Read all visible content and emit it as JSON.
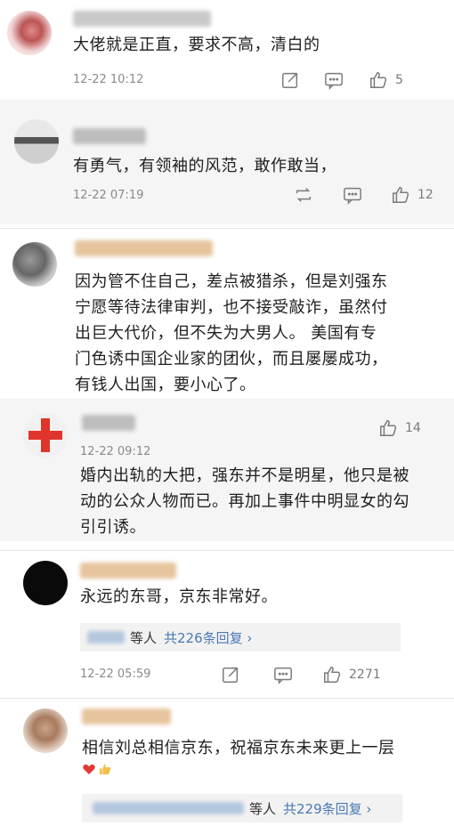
{
  "comments": [
    {
      "text": "大佬就是正直，要求不高，清白的",
      "time": "12-22 10:12",
      "likes": "5"
    },
    {
      "text": "有勇气，有领袖的风范，敢作敢当，",
      "time": "12-22 07:19",
      "likes": "12"
    },
    {
      "lines": [
        "因为管不住自己，差点被猎杀，但是刘强东",
        "宁愿等待法律审判，也不接受敲诈，虽然付",
        "出巨大代价，但不失为大男人。 美国有专",
        "门色诱中国企业家的团伙，而且屡屡成功，",
        "有钱人出国，要小心了。"
      ]
    },
    {
      "time": "12-22 09:12",
      "likes": "14",
      "lines": [
        "婚内出轨的大把，强东并不是明星，他只是被",
        "动的公众人物而已。再加上事件中明显女的勾",
        "引引诱。"
      ]
    },
    {
      "text": "永远的东哥，京东非常好。",
      "reply_others": "等人",
      "reply_link": "共226条回复 ›",
      "time": "12-22 05:59",
      "likes": "2271"
    },
    {
      "text": "相信刘总相信京东，祝福京东未来更上一层",
      "reply_others": "等人",
      "reply_link": "共229条回复 ›"
    }
  ],
  "colors": {
    "link": "#4a78b5",
    "meta": "#8a8a8a",
    "grey_card": "#f5f5f5"
  },
  "icons": [
    "share-icon",
    "comment-icon",
    "like-icon",
    "repost-icon",
    "heart-emoji",
    "thumbs-up-emoji"
  ]
}
